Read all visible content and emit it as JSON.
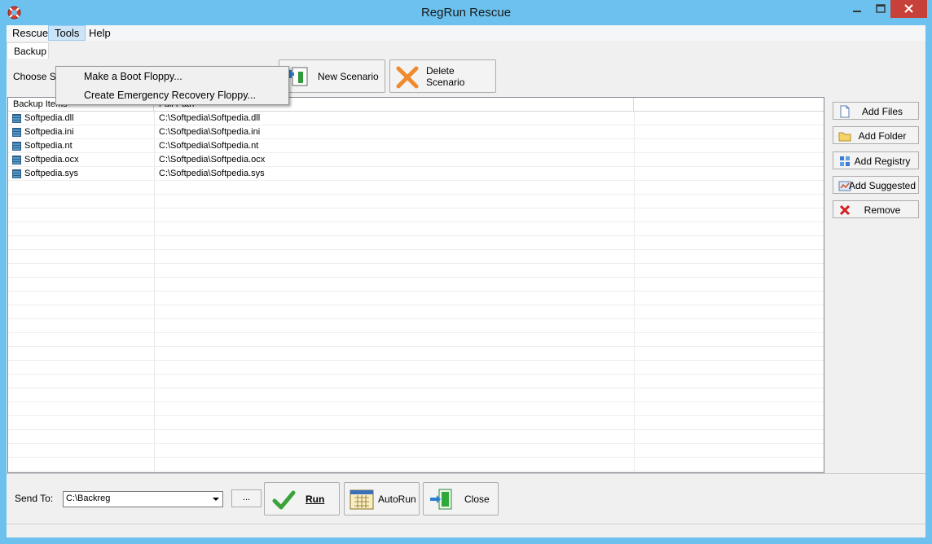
{
  "window": {
    "title": "RegRun Rescue"
  },
  "menu": {
    "rescue": "Rescue",
    "tools": "Tools",
    "help": "Help"
  },
  "tools_menu": {
    "boot_floppy": "Make a Boot Floppy...",
    "recovery_floppy": "Create Emergency Recovery  Floppy..."
  },
  "tab": {
    "backup": "Backup"
  },
  "scenario": {
    "choose_label": "Choose S",
    "new_label": "New Scenario",
    "delete_label": "Delete Scenario"
  },
  "list": {
    "headers": [
      "Backup Items",
      "Full Path"
    ],
    "rows": [
      {
        "name": "Softpedia.dll",
        "path": "C:\\Softpedia\\Softpedia.dll"
      },
      {
        "name": "Softpedia.ini",
        "path": "C:\\Softpedia\\Softpedia.ini"
      },
      {
        "name": "Softpedia.nt",
        "path": "C:\\Softpedia\\Softpedia.nt"
      },
      {
        "name": "Softpedia.ocx",
        "path": "C:\\Softpedia\\Softpedia.ocx"
      },
      {
        "name": "Softpedia.sys",
        "path": "C:\\Softpedia\\Softpedia.sys"
      }
    ]
  },
  "side": {
    "add_files": "Add Files",
    "add_folder": "Add Folder",
    "add_registry": "Add Registry",
    "add_suggested": "Add Suggested",
    "remove": "Remove"
  },
  "bottom": {
    "send_to_label": "Send To:",
    "send_to_value": "C:\\Backreg",
    "browse": "...",
    "run": "Run",
    "autorun": "AutoRun",
    "close": "Close"
  },
  "icons": {
    "app": "lifebuoy-icon",
    "file": "file-icon",
    "folder": "folder-icon",
    "registry": "registry-icon",
    "suggested": "suggested-icon",
    "remove": "red-x-icon",
    "run": "green-check-icon",
    "autorun": "calendar-icon",
    "close": "exit-door-icon"
  }
}
